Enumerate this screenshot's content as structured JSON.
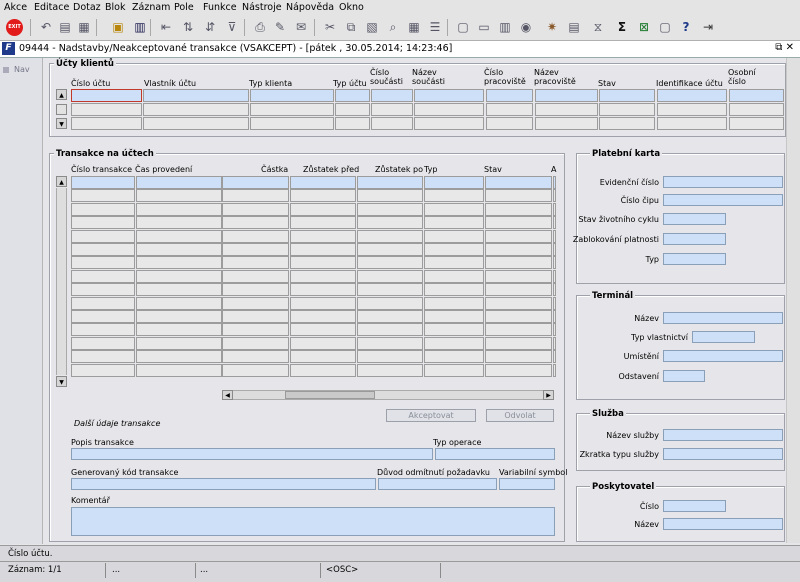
{
  "menu": [
    "Akce",
    "Editace",
    "Dotaz",
    "Blok",
    "Záznam",
    "Pole",
    "Funkce",
    "Nástroje",
    "Nápověda",
    "Okno"
  ],
  "toolbar": {
    "exit_label": "EXIT",
    "icons": [
      "save-icon",
      "print-icon",
      "cut-icon",
      "copy-icon",
      "paste-icon",
      "filter-icon",
      "sort-icon",
      "query-icon",
      "record-icon",
      "calc-icon",
      "globe-icon",
      "sum-icon",
      "excel-icon",
      "help-icon",
      "exit-icon"
    ]
  },
  "window": {
    "title": "09444 - Nadstavby/Neakceptované transakce (VSAKCEPT) - [pátek  , 30.05.2014; 14:23:46]",
    "icon": "F",
    "controls": "⧉ ✕"
  },
  "nav": {
    "label": "Nav"
  },
  "clients": {
    "title": "Účty klientů",
    "columns": [
      "Číslo účtu",
      "Vlastník účtu",
      "Typ klienta",
      "Typ účtu",
      "Číslo součásti",
      "Název součásti",
      "Číslo pracoviště",
      "Název pracoviště",
      "Stav",
      "Identifikace účtu",
      "Osobní číslo"
    ]
  },
  "transactions": {
    "title": "Transakce na účtech",
    "columns": [
      "Číslo transakce",
      "Čas provedení",
      "Částka",
      "Zůstatek před",
      "Zůstatek po",
      "Typ",
      "Stav",
      "A"
    ],
    "accept_label": "Akceptovat",
    "revoke_label": "Odvolat",
    "extra_title": "Další údaje transakce",
    "popis_label": "Popis transakce",
    "typ_operace_label": "Typ operace",
    "gen_kod_label": "Generovaný kód transakce",
    "duvod_label": "Důvod odmítnutí požadavku",
    "var_symbol_label": "Variabilní symbol",
    "komentar_label": "Komentář"
  },
  "card": {
    "title": "Platební karta",
    "evidencni": "Evidenční číslo",
    "cislo_cipu": "Číslo čipu",
    "stav": "Stav životního cyklu",
    "zablokovani": "Zablokování platnosti",
    "typ": "Typ"
  },
  "terminal": {
    "title": "Terminál",
    "nazev": "Název",
    "typ_vlastnictvi": "Typ vlastnictví",
    "umisteni": "Umístění",
    "odstaveni": "Odstavení"
  },
  "service": {
    "title": "Služba",
    "nazev": "Název služby",
    "zkratka": "Zkratka typu služby"
  },
  "provider": {
    "title": "Poskytovatel",
    "cislo": "Číslo",
    "nazev": "Název"
  },
  "status": {
    "hint": "Číslo účtu.",
    "record": "Záznam: 1/1",
    "dots1": "...",
    "dots2": "...",
    "osc": "<OSC>"
  },
  "colors": {
    "field": "#cde0f7",
    "frame_bg": "#e6e6ea"
  }
}
